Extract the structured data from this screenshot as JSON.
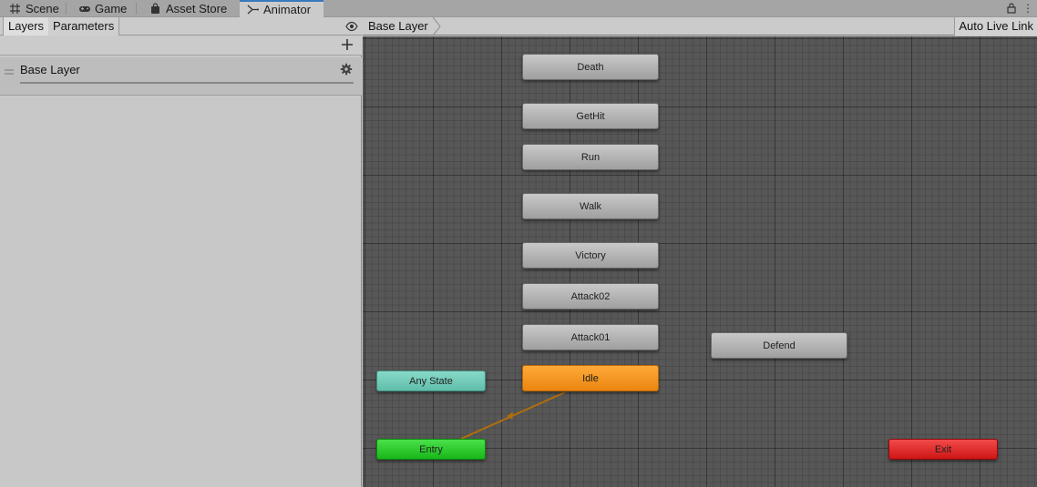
{
  "tabs": [
    {
      "label": "Scene",
      "icon": "grid-icon"
    },
    {
      "label": "Game",
      "icon": "gamepad-icon"
    },
    {
      "label": "Asset Store",
      "icon": "shopping-bag-icon"
    },
    {
      "label": "Animator",
      "icon": "animator-icon",
      "active": true
    }
  ],
  "left_panel": {
    "tabs": {
      "layers": "Layers",
      "parameters": "Parameters"
    },
    "layers": [
      {
        "name": "Base Layer"
      }
    ]
  },
  "graph": {
    "breadcrumb": "Base Layer",
    "auto_live_link": "Auto Live Link",
    "states": {
      "death": "Death",
      "gethit": "GetHit",
      "run": "Run",
      "walk": "Walk",
      "victory": "Victory",
      "attack02": "Attack02",
      "attack01": "Attack01",
      "defend": "Defend",
      "idle": "Idle",
      "any_state": "Any State",
      "entry": "Entry",
      "exit": "Exit"
    },
    "default_state": "Idle",
    "colors": {
      "idle": "#f0901c",
      "any_state": "#6fc9b6",
      "entry": "#22c122",
      "exit": "#dd2222",
      "transition": "#b06e0c",
      "tab_accent": "#3a79bb"
    }
  }
}
